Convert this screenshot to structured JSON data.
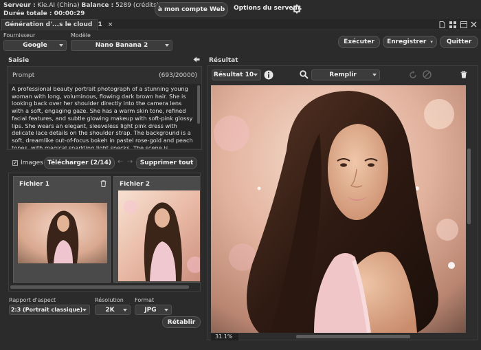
{
  "header": {
    "server_label": "Serveur :",
    "server_value": "Kie.AI (China)",
    "balance_label": "Balance :",
    "balance_value": "5289 (crédits)",
    "duration_label": "Durée totale :",
    "duration_value": "00:00:29",
    "account_button": "à mon compte Web",
    "server_options": "Options du serveur"
  },
  "tab": {
    "label": "Génération d'...s le cloud",
    "count": "1"
  },
  "toolbar": {
    "provider_label": "Fournisseur",
    "provider_value": "Google",
    "model_label": "Modèle",
    "model_value": "Nano Banana 2",
    "run_button": "Exécuter",
    "save_button": "Enregistrer",
    "quit_button": "Quitter"
  },
  "input": {
    "section_title": "Saisie",
    "prompt_label": "Prompt",
    "prompt_count": "(693/20000)",
    "prompt_text": "A professional beauty portrait photograph of a stunning young woman with long, voluminous, flowing dark brown hair. She is looking back over her shoulder directly into the camera lens with a soft, engaging gaze. She has a warm skin tone, refined facial features, and subtle glowing makeup with soft-pink glossy lips. She wears an elegant, sleeveless light pink dress with delicate lace details on the shoulder strap. The background is a soft, dreamlike out-of-focus bokeh in pastel rose-gold and peach tones, with magical sparkling light specks. The scene is illuminated by warm,",
    "images_label": "Images",
    "upload_button": "Télécharger (2/14)",
    "delete_all_button": "Supprimer tout",
    "files": [
      {
        "name": "Fichier 1"
      },
      {
        "name": "Fichier 2"
      }
    ],
    "aspect_label": "Rapport d'aspect",
    "aspect_value": "2:3 (Portrait classique)",
    "resolution_label": "Résolution",
    "resolution_value": "2K",
    "format_label": "Format",
    "format_value": "JPG",
    "reset_button": "Rétablir"
  },
  "result": {
    "section_title": "Résultat",
    "result_select": "Résultat 10",
    "fill_select": "Remplir",
    "zoom": "31.1%"
  }
}
